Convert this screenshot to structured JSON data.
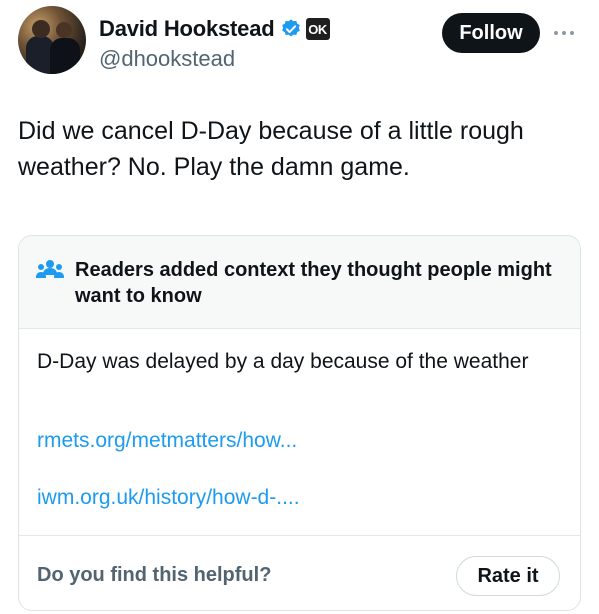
{
  "author": {
    "display_name": "David Hookstead",
    "handle": "@dhookstead",
    "badge_text": "OK",
    "verified_icon": "verified-check-icon",
    "verified_color": "#1d9bf0"
  },
  "actions": {
    "follow_label": "Follow",
    "more_icon": "more-horizontal-icon"
  },
  "tweet": {
    "text": "Did we cancel D-Day because of a little rough weather? No. Play the damn game."
  },
  "community_note": {
    "icon": "people-icon",
    "title": "Readers added context they thought people might want to know",
    "body": "D-Day was delayed by a day because of the weather",
    "links": [
      "rmets.org/metmatters/how...",
      "iwm.org.uk/history/how-d-...."
    ],
    "helpful_prompt": "Do you find this helpful?",
    "rate_label": "Rate it",
    "link_color": "#1d9bf0"
  }
}
